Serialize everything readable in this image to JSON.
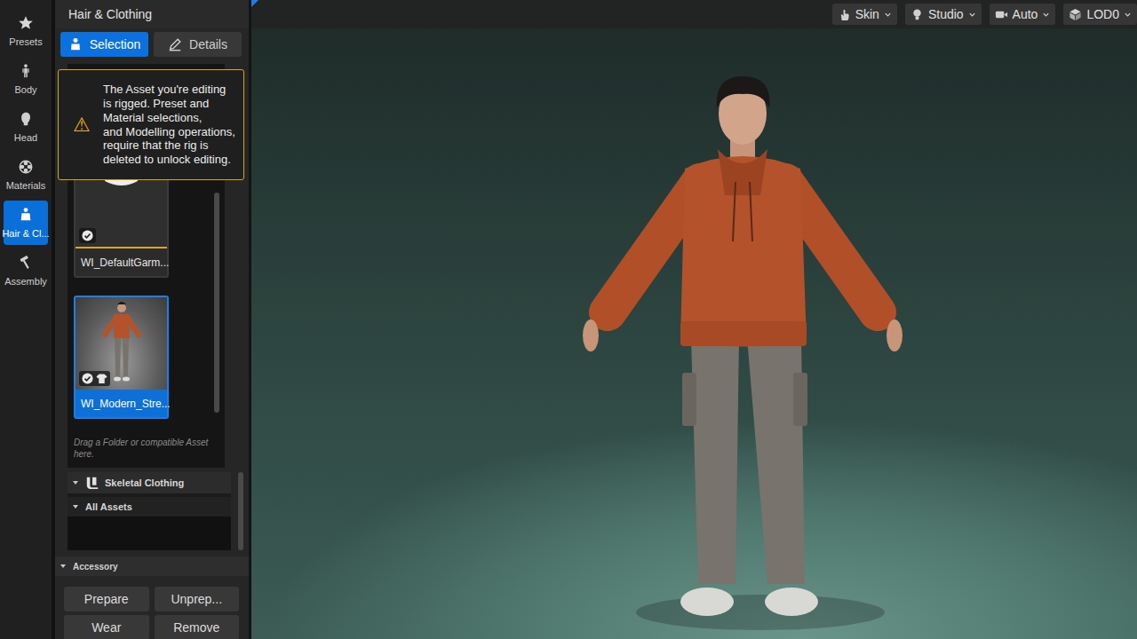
{
  "panel": {
    "title": "Hair & Clothing",
    "tabs": [
      {
        "label": "Selection",
        "selected": true
      },
      {
        "label": "Details",
        "selected": false
      }
    ]
  },
  "nav": [
    {
      "label": "Presets",
      "selected": false
    },
    {
      "label": "Body",
      "selected": false
    },
    {
      "label": "Head",
      "selected": false
    },
    {
      "label": "Materials",
      "selected": false
    },
    {
      "label": "Hair & Cl...",
      "selected": true
    },
    {
      "label": "Assembly",
      "selected": false
    }
  ],
  "warning": {
    "icon": "⚠",
    "text": "The Asset you're editing is rigged. Preset and Material selections,\nand Modelling operations, require that the rig is deleted to unlock editing."
  },
  "assets": [
    {
      "name": "WI_DefaultGarm...",
      "selected": false,
      "checked": true,
      "kind": "garment"
    },
    {
      "name": "WI_Modern_Stre...",
      "selected": true,
      "checked": true,
      "kind": "outfit"
    }
  ],
  "drop_hint": "Drag a Folder or compatible Asset here.",
  "sections": [
    {
      "label": "Skeletal Clothing",
      "expanded": true,
      "kind": "category"
    },
    {
      "label": "All Assets",
      "expanded": true,
      "kind": "filter"
    }
  ],
  "accessory": {
    "title": "Accessory",
    "expanded": true,
    "buttons": [
      "Prepare",
      "Unprep...",
      "Wear",
      "Remove"
    ]
  },
  "viewport": {
    "toolbar": [
      "Skin",
      "Studio",
      "Auto",
      "LOD0"
    ]
  }
}
